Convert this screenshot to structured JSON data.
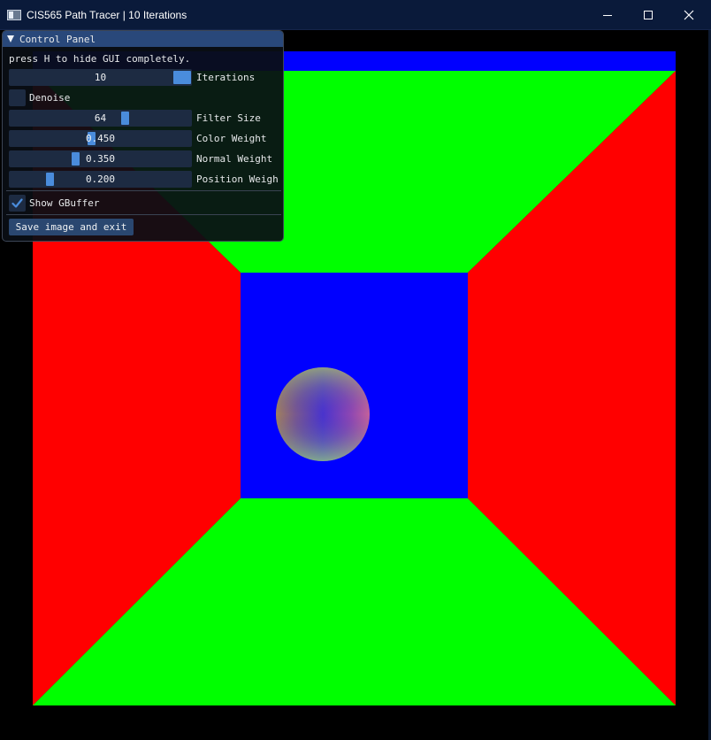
{
  "window": {
    "title": "CIS565 Path Tracer | 10 Iterations",
    "app_icon": "window-app-icon",
    "controls": {
      "minimize": "minimize-icon",
      "maximize": "maximize-icon",
      "close": "close-icon"
    }
  },
  "render": {
    "description_colors": {
      "background": "#000000",
      "left_wall": "#ff0000",
      "right_wall": "#ff0000",
      "floor": "#00ff00",
      "ceiling": "#00ff00",
      "back_wall": "#0000ff",
      "light": "#0000ff"
    }
  },
  "panel": {
    "title": "Control Panel",
    "collapse_icon": "collapse-triangle-icon",
    "hint": "press H to hide GUI completely.",
    "iterations": {
      "value": "10",
      "label": "Iterations"
    },
    "denoise": {
      "label": "Denoise",
      "checked": false
    },
    "filter_size": {
      "value": "64",
      "label": "Filter Size"
    },
    "color_weight": {
      "value": "0.450",
      "label": "Color Weight"
    },
    "normal_weight": {
      "value": "0.350",
      "label": "Normal Weight"
    },
    "position_weight": {
      "value": "0.200",
      "label": "Position Weigh"
    },
    "show_gbuffer": {
      "label": "Show GBuffer",
      "checked": true
    },
    "save_button": "Save image and exit",
    "accent": "#4a8cdc",
    "header_color": "#29487a"
  }
}
